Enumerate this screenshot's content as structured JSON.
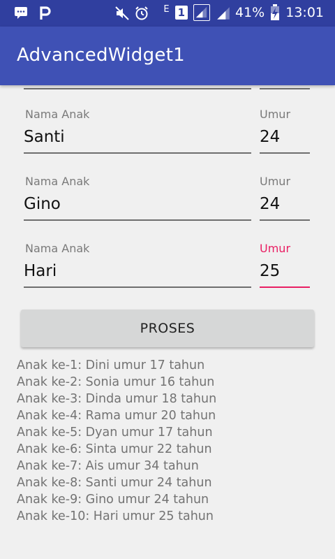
{
  "status_bar": {
    "battery": "41%",
    "time": "13:01",
    "network_type": "E",
    "sim_slot": "1",
    "icons": [
      "bbm-icon",
      "p-logo-icon",
      "mute-icon",
      "alarm-clock-icon",
      "signal-icon",
      "signal-icon-2",
      "battery-charging-icon"
    ]
  },
  "app_bar": {
    "title": "AdvancedWidget1"
  },
  "form": {
    "rows": [
      {
        "name_label": "Nama Anak",
        "name_value": "Santi",
        "age_label": "Umur",
        "age_value": "24"
      },
      {
        "name_label": "Nama Anak",
        "name_value": "Gino",
        "age_label": "Umur",
        "age_value": "24"
      },
      {
        "name_label": "Nama Anak",
        "name_value": "Hari",
        "age_label": "Umur",
        "age_value": "25"
      }
    ],
    "button_label": "PROSES"
  },
  "results": [
    "Anak ke-1: Dini umur 17 tahun",
    "Anak ke-2: Sonia umur 16 tahun",
    "Anak ke-3: Dinda umur 18 tahun",
    "Anak ke-4: Rama umur 20 tahun",
    "Anak ke-5: Dyan umur 17 tahun",
    "Anak ke-6: Sinta umur 22 tahun",
    "Anak ke-7: Ais umur 34 tahun",
    "Anak ke-8: Santi umur 24 tahun",
    "Anak ke-9: Gino umur 24 tahun",
    "Anak ke-10: Hari umur 25 tahun"
  ],
  "colors": {
    "status_bar": "#303f9f",
    "app_bar": "#3f51b5",
    "accent": "#e91e63",
    "background": "#f0f0f0"
  }
}
